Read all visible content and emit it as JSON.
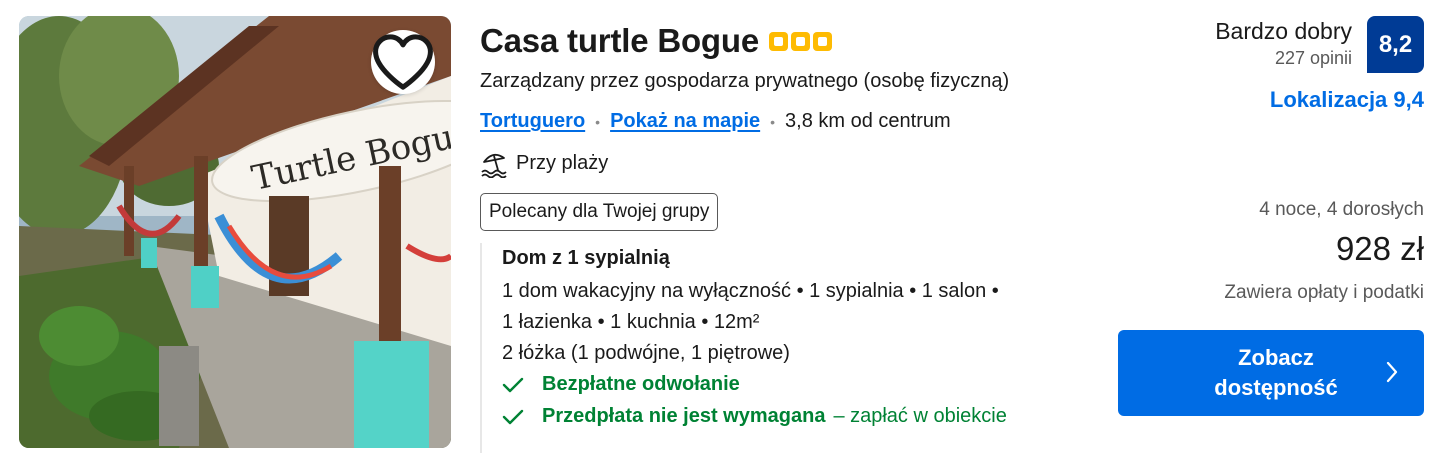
{
  "property": {
    "name": "Casa turtle Bogue",
    "stars": 3,
    "host": "Zarządzany przez gospodarza prywatnego (osobę fizyczną)",
    "location_link": "Tortuguero",
    "map_link": "Pokaż na mapie",
    "distance": "3,8 km od centrum",
    "beach": "Przy plaży",
    "recommended_badge": "Polecany dla Twojej grupy",
    "image_sign_text": "Turtle Bogue"
  },
  "unit": {
    "title": "Dom z 1 sypialnią",
    "details_line1": "1 dom wakacyjny na wyłączność • 1 sypialnia • 1 salon •",
    "details_line2": "1 łazienka • 1 kuchnia • 12m²",
    "beds": "2 łóżka (1 podwójne, 1 piętrowe)",
    "perk_cancel": "Bezpłatne odwołanie",
    "perk_prepay": "Przedpłata nie jest wymagana",
    "perk_prepay_note": "– zapłać w obiekcie"
  },
  "review": {
    "label": "Bardzo dobry",
    "count": "227 opinii",
    "score": "8,2",
    "location_score": "Lokalizacja 9,4"
  },
  "pricing": {
    "stay_info": "4 noce, 4 dorosłych",
    "price": "928 zł",
    "tax_note": "Zawiera opłaty i podatki",
    "cta_label": "Zobacz dostępność"
  },
  "colors": {
    "link": "#006ce4",
    "score_badge": "#003b95",
    "green": "#008234",
    "star": "#febb02",
    "cta": "#006ce4"
  },
  "icons": {
    "favorite": "heart-icon",
    "beach": "beach-umbrella-icon",
    "check": "check-icon",
    "chevron": "chevron-right-icon"
  }
}
